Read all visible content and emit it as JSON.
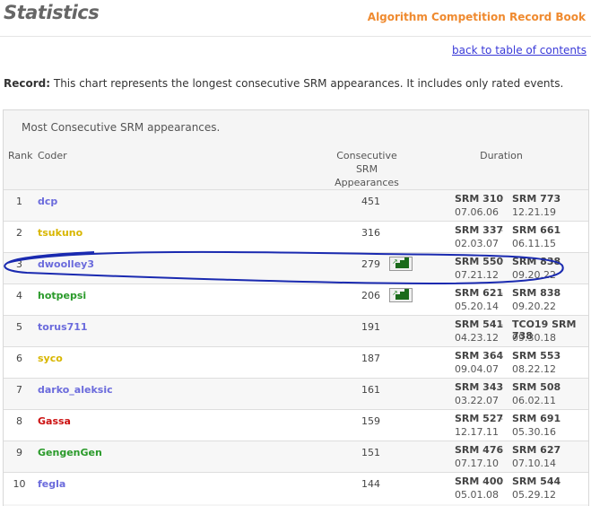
{
  "header": {
    "title": "Statistics",
    "book": "Algorithm Competition Record Book",
    "back_link": "back to table of contents"
  },
  "record": {
    "label": "Record:",
    "text": " This chart represents the longest consecutive SRM appearances. It includes only rated events."
  },
  "table": {
    "caption": "Most Consecutive SRM appearances.",
    "headers": {
      "rank": "Rank",
      "coder": "Coder",
      "apps_1": "Consecutive",
      "apps_2": "SRM",
      "apps_3": "Appearances",
      "duration": "Duration"
    },
    "dash": "-",
    "rows": [
      {
        "rank": "1",
        "coder": "dcp",
        "color": "#6b6bdc",
        "apps": "451",
        "icon": false,
        "start": "SRM 310",
        "start_date": "07.06.06",
        "end": "SRM 773",
        "end_date": "12.21.19"
      },
      {
        "rank": "2",
        "coder": "tsukuno",
        "color": "#d8b600",
        "apps": "316",
        "icon": false,
        "start": "SRM 337",
        "start_date": "02.03.07",
        "end": "SRM 661",
        "end_date": "06.11.15"
      },
      {
        "rank": "3",
        "coder": "dwoolley3",
        "color": "#6b6bdc",
        "apps": "279",
        "icon": true,
        "start": "SRM 550",
        "start_date": "07.21.12",
        "end": "SRM 838",
        "end_date": "09.20.22"
      },
      {
        "rank": "4",
        "coder": "hotpepsi",
        "color": "#2a9a2a",
        "apps": "206",
        "icon": true,
        "start": "SRM 621",
        "start_date": "05.20.14",
        "end": "SRM 838",
        "end_date": "09.20.22"
      },
      {
        "rank": "5",
        "coder": "torus711",
        "color": "#6b6bdc",
        "apps": "191",
        "icon": false,
        "start": "SRM 541",
        "start_date": "04.23.12",
        "end": "TCO19 SRM 738",
        "end_date": "09.30.18"
      },
      {
        "rank": "6",
        "coder": "syco",
        "color": "#d8b600",
        "apps": "187",
        "icon": false,
        "start": "SRM 364",
        "start_date": "09.04.07",
        "end": "SRM 553",
        "end_date": "08.22.12"
      },
      {
        "rank": "7",
        "coder": "darko_aleksic",
        "color": "#6b6bdc",
        "apps": "161",
        "icon": false,
        "start": "SRM 343",
        "start_date": "03.22.07",
        "end": "SRM 508",
        "end_date": "06.02.11"
      },
      {
        "rank": "8",
        "coder": "Gassa",
        "color": "#cc1111",
        "apps": "159",
        "icon": false,
        "start": "SRM 527",
        "start_date": "12.17.11",
        "end": "SRM 691",
        "end_date": "05.30.16"
      },
      {
        "rank": "9",
        "coder": "GengenGen",
        "color": "#2a9a2a",
        "apps": "151",
        "icon": false,
        "start": "SRM 476",
        "start_date": "07.17.10",
        "end": "SRM 627",
        "end_date": "07.10.14"
      },
      {
        "rank": "10",
        "coder": "fegla",
        "color": "#6b6bdc",
        "apps": "144",
        "icon": false,
        "start": "SRM 400",
        "start_date": "05.01.08",
        "end": "SRM 544",
        "end_date": "05.29.12"
      }
    ]
  },
  "colors": {
    "annotation": "#1a2ab0",
    "book_title": "#ef8a2f",
    "link": "#3a3ad8"
  }
}
